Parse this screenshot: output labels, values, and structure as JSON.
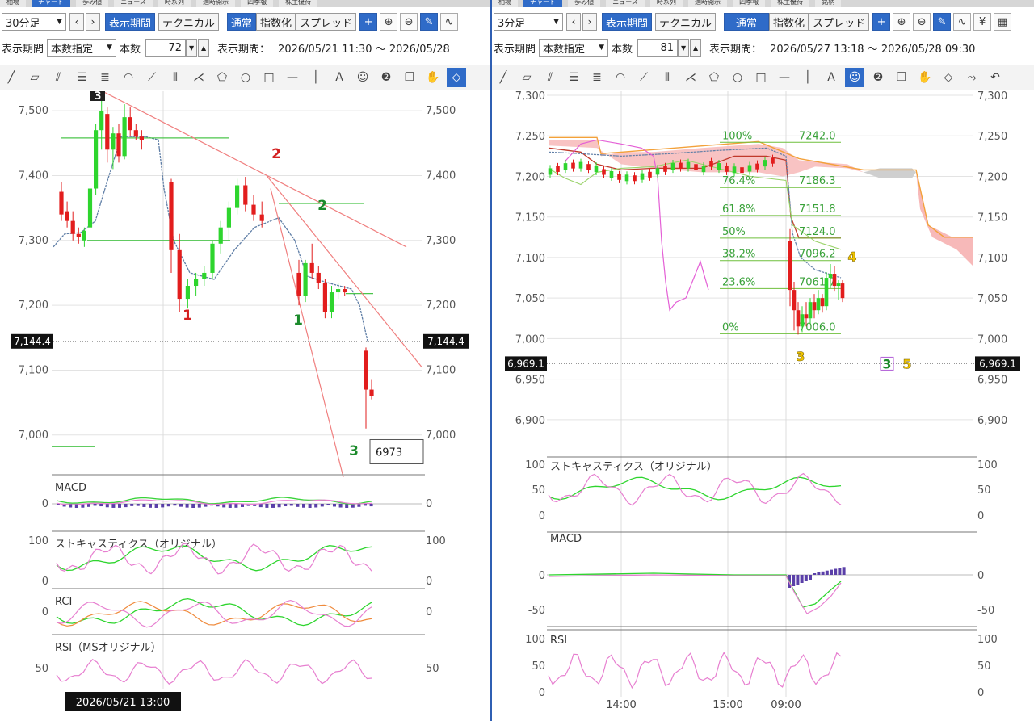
{
  "left": {
    "tabs": [
      "相場",
      "チャート",
      "歩み値",
      "ニュース",
      "時系列",
      "適時開示",
      "四季報",
      "株主優待"
    ],
    "timeframe": "30分足",
    "btn_display_period": "表示期間",
    "btn_technical": "テクニカル",
    "btn_normal": "通常",
    "btn_index": "指数化",
    "btn_spread": "スプレッド",
    "period_mode": "本数指定",
    "count_label": "本数",
    "count_value": "72",
    "period_label": "表示期間：",
    "period_range": "2026/05/21 11:30 ～ 2026/05/28",
    "chart_data": {
      "type": "candlestick",
      "ylim": [
        6940,
        7530
      ],
      "yticks": [
        7000,
        7100,
        7200,
        7300,
        7400,
        7500
      ],
      "ytick_labels": [
        "7,000",
        "7,100",
        "7,200",
        "7,300",
        "7,400",
        "7,500"
      ],
      "current_price_label": "7,144.4",
      "current_price": 7144.4,
      "price_box": "6973",
      "price_box_value": 6973,
      "date_label": "2026/05/21 13:00",
      "candles": [
        {
          "o": 7375,
          "h": 7390,
          "l": 7330,
          "c": 7340
        },
        {
          "o": 7345,
          "h": 7360,
          "l": 7320,
          "c": 7330
        },
        {
          "o": 7330,
          "h": 7345,
          "l": 7300,
          "c": 7310
        },
        {
          "o": 7310,
          "h": 7320,
          "l": 7295,
          "c": 7305
        },
        {
          "o": 7300,
          "h": 7320,
          "l": 7290,
          "c": 7315
        },
        {
          "o": 7320,
          "h": 7390,
          "l": 7300,
          "c": 7380
        },
        {
          "o": 7380,
          "h": 7480,
          "l": 7370,
          "c": 7470
        },
        {
          "o": 7470,
          "h": 7530,
          "l": 7440,
          "c": 7500
        },
        {
          "o": 7495,
          "h": 7505,
          "l": 7420,
          "c": 7440
        },
        {
          "o": 7440,
          "h": 7475,
          "l": 7410,
          "c": 7465
        },
        {
          "o": 7465,
          "h": 7480,
          "l": 7420,
          "c": 7430
        },
        {
          "o": 7430,
          "h": 7510,
          "l": 7425,
          "c": 7490
        },
        {
          "o": 7490,
          "h": 7505,
          "l": 7460,
          "c": 7470
        },
        {
          "o": 7470,
          "h": 7480,
          "l": 7455,
          "c": 7460
        },
        {
          "o": 7460,
          "h": 7470,
          "l": 7440,
          "c": 7455
        },
        {
          "o": 7390,
          "h": 7395,
          "l": 7250,
          "c": 7285
        },
        {
          "o": 7285,
          "h": 7310,
          "l": 7190,
          "c": 7210
        },
        {
          "o": 7210,
          "h": 7240,
          "l": 7195,
          "c": 7230
        },
        {
          "o": 7230,
          "h": 7250,
          "l": 7215,
          "c": 7240
        },
        {
          "o": 7240,
          "h": 7260,
          "l": 7230,
          "c": 7250
        },
        {
          "o": 7250,
          "h": 7300,
          "l": 7240,
          "c": 7295
        },
        {
          "o": 7295,
          "h": 7330,
          "l": 7280,
          "c": 7320
        },
        {
          "o": 7320,
          "h": 7360,
          "l": 7300,
          "c": 7350
        },
        {
          "o": 7350,
          "h": 7395,
          "l": 7340,
          "c": 7385
        },
        {
          "o": 7385,
          "h": 7398,
          "l": 7345,
          "c": 7355
        },
        {
          "o": 7355,
          "h": 7370,
          "l": 7330,
          "c": 7340
        },
        {
          "o": 7340,
          "h": 7360,
          "l": 7320,
          "c": 7330
        },
        {
          "o": 7250,
          "h": 7270,
          "l": 7200,
          "c": 7215
        },
        {
          "o": 7215,
          "h": 7270,
          "l": 7205,
          "c": 7265
        },
        {
          "o": 7265,
          "h": 7295,
          "l": 7240,
          "c": 7250
        },
        {
          "o": 7250,
          "h": 7260,
          "l": 7225,
          "c": 7235
        },
        {
          "o": 7235,
          "h": 7240,
          "l": 7180,
          "c": 7190
        },
        {
          "o": 7190,
          "h": 7230,
          "l": 7180,
          "c": 7220
        },
        {
          "o": 7220,
          "h": 7235,
          "l": 7210,
          "c": 7225
        },
        {
          "o": 7225,
          "h": 7230,
          "l": 7215,
          "c": 7220
        },
        {
          "o": 7130,
          "h": 7135,
          "l": 7010,
          "c": 7070
        },
        {
          "o": 7070,
          "h": 7085,
          "l": 7055,
          "c": 7060
        }
      ],
      "annotations": [
        "3",
        "2",
        "2",
        "1",
        "1",
        "3"
      ]
    },
    "macd": {
      "title": "MACD",
      "tick_zero": "0"
    },
    "stoch": {
      "title": "ストキャスティクス（オリジナル）",
      "tick_100": "100",
      "tick_0": "0"
    },
    "rci": {
      "title": "RCI",
      "tick_zero": "0"
    },
    "rsi": {
      "title": "RSI（MSオリジナル）",
      "tick_50": "50"
    }
  },
  "right": {
    "tabs": [
      "相場",
      "チャート",
      "歩み値",
      "ニュース",
      "時系列",
      "適時開示",
      "四季報",
      "株主優待",
      "銘柄"
    ],
    "timeframe": "3分足",
    "btn_display_period": "表示期間",
    "btn_technical": "テクニカル",
    "btn_normal": "通常",
    "btn_index": "指数化",
    "btn_spread": "スプレッド",
    "period_mode": "本数指定",
    "count_label": "本数",
    "count_value": "81",
    "period_label": "表示期間：",
    "period_range": "2026/05/27 13:18 ～ 2026/05/28 09:30",
    "chart_data": {
      "type": "candlestick",
      "ylim": [
        6860,
        7305
      ],
      "yticks": [
        6900,
        6950,
        7000,
        7050,
        7100,
        7150,
        7200,
        7250,
        7300
      ],
      "ytick_labels": [
        "6,900",
        "6,950",
        "7,000",
        "7,050",
        "7,100",
        "7,150",
        "7,200",
        "7,250",
        "7,300"
      ],
      "current_price_label": "6,969.1",
      "current_price": 6969.1,
      "xticks": [
        "14:00",
        "15:00",
        "09:00"
      ],
      "fibonacci": [
        {
          "pct": "100%",
          "val": "7242.0",
          "price": 7242.0
        },
        {
          "pct": "76.4%",
          "val": "7186.3",
          "price": 7186.3
        },
        {
          "pct": "61.8%",
          "val": "7151.8",
          "price": 7151.8
        },
        {
          "pct": "50%",
          "val": "7124.0",
          "price": 7124.0
        },
        {
          "pct": "38.2%",
          "val": "7096.2",
          "price": 7096.2
        },
        {
          "pct": "23.6%",
          "val": "7061.7",
          "price": 7061.7
        },
        {
          "pct": "0%",
          "val": "7006.0",
          "price": 7006.0
        }
      ],
      "annotations": [
        "4",
        "3",
        "3",
        "5"
      ]
    },
    "stoch": {
      "title": "ストキャスティクス（オリジナル）",
      "tick_100": "100",
      "tick_50": "50",
      "tick_0": "0"
    },
    "macd": {
      "title": "MACD",
      "tick_zero": "0",
      "tick_neg50": "-50"
    },
    "rsi": {
      "title": "RSI",
      "tick_100": "100",
      "tick_50": "50",
      "tick_0": "0"
    }
  }
}
